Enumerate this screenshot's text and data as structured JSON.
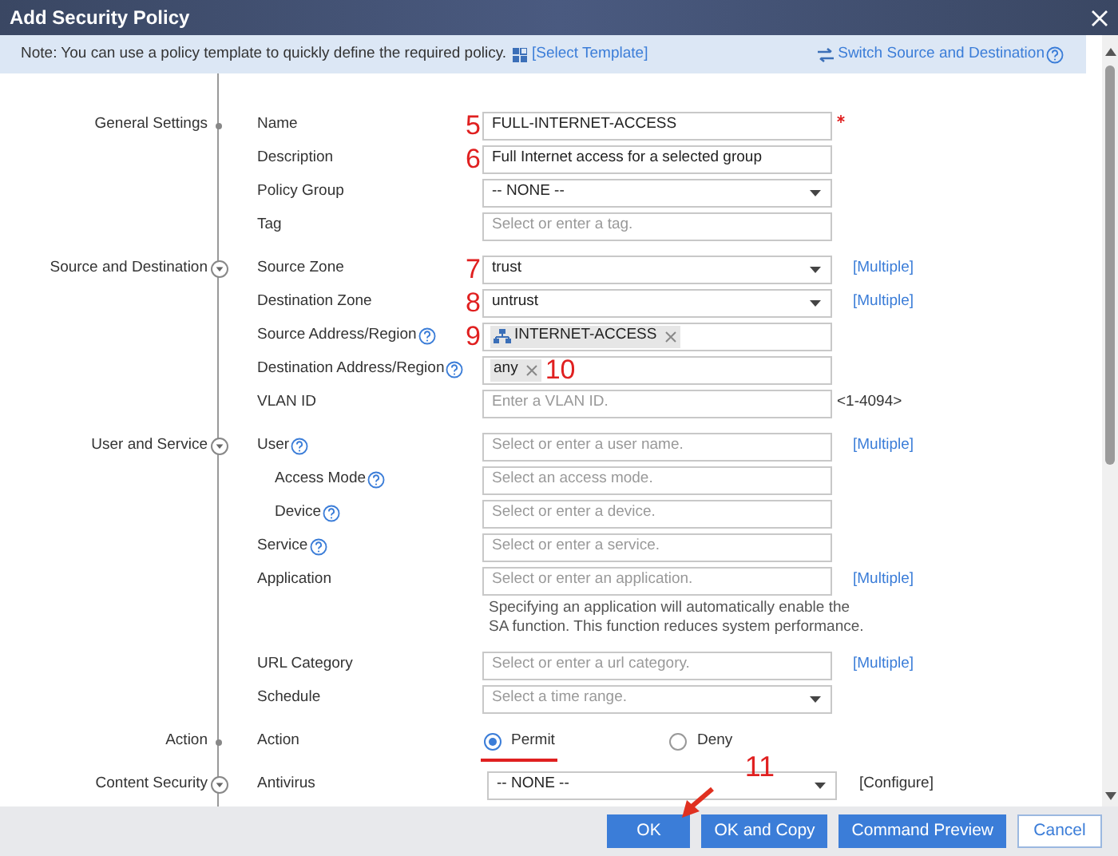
{
  "window": {
    "title": "Add Security Policy"
  },
  "note": {
    "text": "Note: You can use a policy template to quickly define the required policy.",
    "template_link": "[Select Template]",
    "switch_link": "Switch Source and Destination",
    "switch_help": true
  },
  "sections": [
    {
      "label": "General Settings",
      "collapsible": false,
      "rows": [
        {
          "label": "Name",
          "kind": "text",
          "value": "FULL-INTERNET-ACCESS",
          "required": true,
          "annotation": "5"
        },
        {
          "label": "Description",
          "kind": "text",
          "value": "Full Internet access for a selected group",
          "annotation": "6"
        },
        {
          "label": "Policy Group",
          "kind": "select",
          "value": "-- NONE --"
        },
        {
          "label": "Tag",
          "kind": "text",
          "placeholder": "Select or enter a tag."
        }
      ]
    },
    {
      "label": "Source and Destination",
      "collapsible": true,
      "rows": [
        {
          "label": "Source Zone",
          "kind": "select",
          "value": "trust",
          "annotation": "7",
          "extra": "[Multiple]"
        },
        {
          "label": "Destination Zone",
          "kind": "select",
          "value": "untrust",
          "annotation": "8",
          "extra": "[Multiple]"
        },
        {
          "label": "Source Address/Region",
          "help": true,
          "kind": "chips",
          "chips": [
            {
              "label": "INTERNET-ACCESS",
              "icon": true
            }
          ],
          "annotation": "9"
        },
        {
          "label": "Destination Address/Region",
          "help": true,
          "kind": "chips",
          "chips": [
            {
              "label": "any",
              "icon": false
            }
          ],
          "chip_annotation": "10"
        },
        {
          "label": "VLAN ID",
          "kind": "text",
          "placeholder": "Enter a VLAN ID.",
          "extra_plain": "<1-4094>"
        }
      ]
    },
    {
      "label": "User and Service",
      "collapsible": true,
      "rows": [
        {
          "label": "User",
          "help": true,
          "kind": "text",
          "placeholder": "Select or enter a user name.",
          "extra": "[Multiple]"
        },
        {
          "label": "Access Mode",
          "help": true,
          "indent": true,
          "kind": "text",
          "placeholder": "Select an access mode."
        },
        {
          "label": "Device",
          "help": true,
          "indent": true,
          "kind": "text",
          "placeholder": "Select or enter a device."
        },
        {
          "label": "Service",
          "help": true,
          "kind": "text",
          "placeholder": "Select or enter a service."
        },
        {
          "label": "Application",
          "kind": "text",
          "placeholder": "Select or enter an application.",
          "extra": "[Multiple]"
        },
        {
          "kind": "note",
          "text": "Specifying an application will automatically enable the SA function. This function reduces system performance."
        },
        {
          "label": "URL Category",
          "kind": "text",
          "placeholder": "Select or enter a url category.",
          "extra": "[Multiple]"
        },
        {
          "label": "Schedule",
          "kind": "select",
          "placeholder": "Select a time range."
        }
      ]
    },
    {
      "label": "Action",
      "collapsible": false,
      "rows": [
        {
          "label": "Action",
          "kind": "radio",
          "options": [
            {
              "label": "Permit",
              "selected": true,
              "underlined": true
            },
            {
              "label": "Deny",
              "selected": false,
              "underlined": false
            }
          ]
        }
      ]
    },
    {
      "label": "Content Security",
      "collapsible": true,
      "rows": [
        {
          "label": "Antivirus",
          "kind": "select",
          "value": "-- NONE --",
          "extra_plain": "[Configure]"
        }
      ]
    }
  ],
  "buttons": [
    {
      "label": "OK",
      "kind": "primary",
      "annotation": "11"
    },
    {
      "label": "OK and Copy",
      "kind": "primary"
    },
    {
      "label": "Command Preview",
      "kind": "primary"
    },
    {
      "label": "Cancel",
      "kind": "secondary"
    }
  ]
}
